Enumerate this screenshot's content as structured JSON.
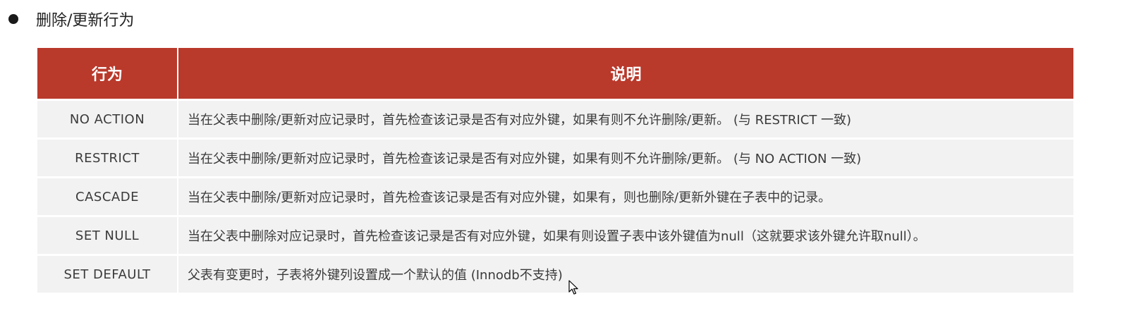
{
  "heading": {
    "text": "删除/更新行为"
  },
  "table": {
    "headers": [
      "行为",
      "说明"
    ],
    "rows": [
      {
        "action": "NO  ACTION",
        "description": "当在父表中删除/更新对应记录时，首先检查该记录是否有对应外键，如果有则不允许删除/更新。 (与 RESTRICT 一致)"
      },
      {
        "action": "RESTRICT",
        "description": "当在父表中删除/更新对应记录时，首先检查该记录是否有对应外键，如果有则不允许删除/更新。 (与 NO ACTION 一致)"
      },
      {
        "action": "CASCADE",
        "description": "当在父表中删除/更新对应记录时，首先检查该记录是否有对应外键，如果有，则也删除/更新外键在子表中的记录。"
      },
      {
        "action": "SET  NULL",
        "description": "当在父表中删除对应记录时，首先检查该记录是否有对应外键，如果有则设置子表中该外键值为null（这就要求该外键允许取null）。"
      },
      {
        "action": "SET  DEFAULT",
        "description": "父表有变更时，子表将外键列设置成一个默认的值 (Innodb不支持)"
      }
    ]
  },
  "colors": {
    "header_background": "#b9392b",
    "row_background": "#f2f2f2"
  }
}
